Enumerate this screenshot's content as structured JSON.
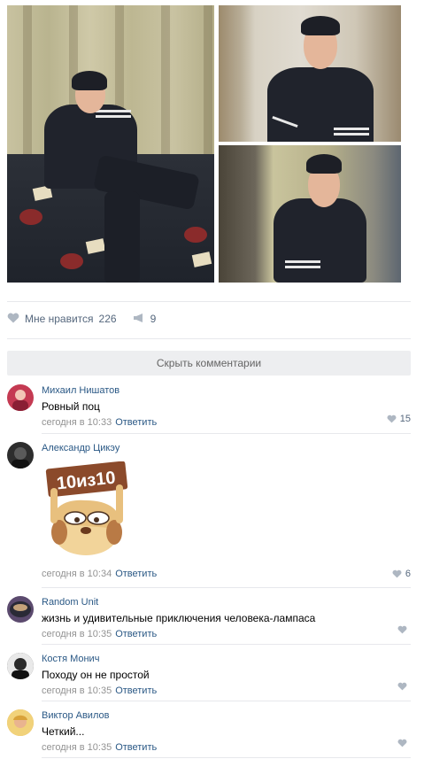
{
  "post": {
    "photos": [
      {
        "name": "bed-photo"
      },
      {
        "name": "door-photo"
      },
      {
        "name": "room-photo"
      }
    ],
    "likes_label": "Мне нравится",
    "likes_count": "226",
    "reposts_count": "9",
    "hide_comments_label": "Скрыть комментарии"
  },
  "comments": [
    {
      "author": "Михаил Нишатов",
      "text": "Ровный поц",
      "time": "сегодня в 10:33",
      "reply": "Ответить",
      "likes": "15",
      "avatar_color": "#c43a52"
    },
    {
      "author": "Александр Цикэу",
      "text": "",
      "sticker_text": "10из10",
      "time": "сегодня в 10:34",
      "reply": "Ответить",
      "likes": "6",
      "avatar_color": "#2d2d2d"
    },
    {
      "author": "Random Unit",
      "text": "жизнь и удивительные приключения человека-лампаса",
      "time": "сегодня в 10:35",
      "reply": "Ответить",
      "likes": "",
      "avatar_color": "#5b4a6e"
    },
    {
      "author": "Костя Монич",
      "text": "Походу он не простой",
      "time": "сегодня в 10:35",
      "reply": "Ответить",
      "likes": "",
      "avatar_color": "#3a3a3a"
    },
    {
      "author": "Виктор Авилов",
      "text": "Четкий...",
      "time": "сегодня в 10:35",
      "reply": "Ответить",
      "likes": "",
      "avatar_color": "#e6b35c"
    }
  ],
  "colors": {
    "link": "#2a5885",
    "meta": "#939393",
    "accent_bg": "#edeef0"
  }
}
